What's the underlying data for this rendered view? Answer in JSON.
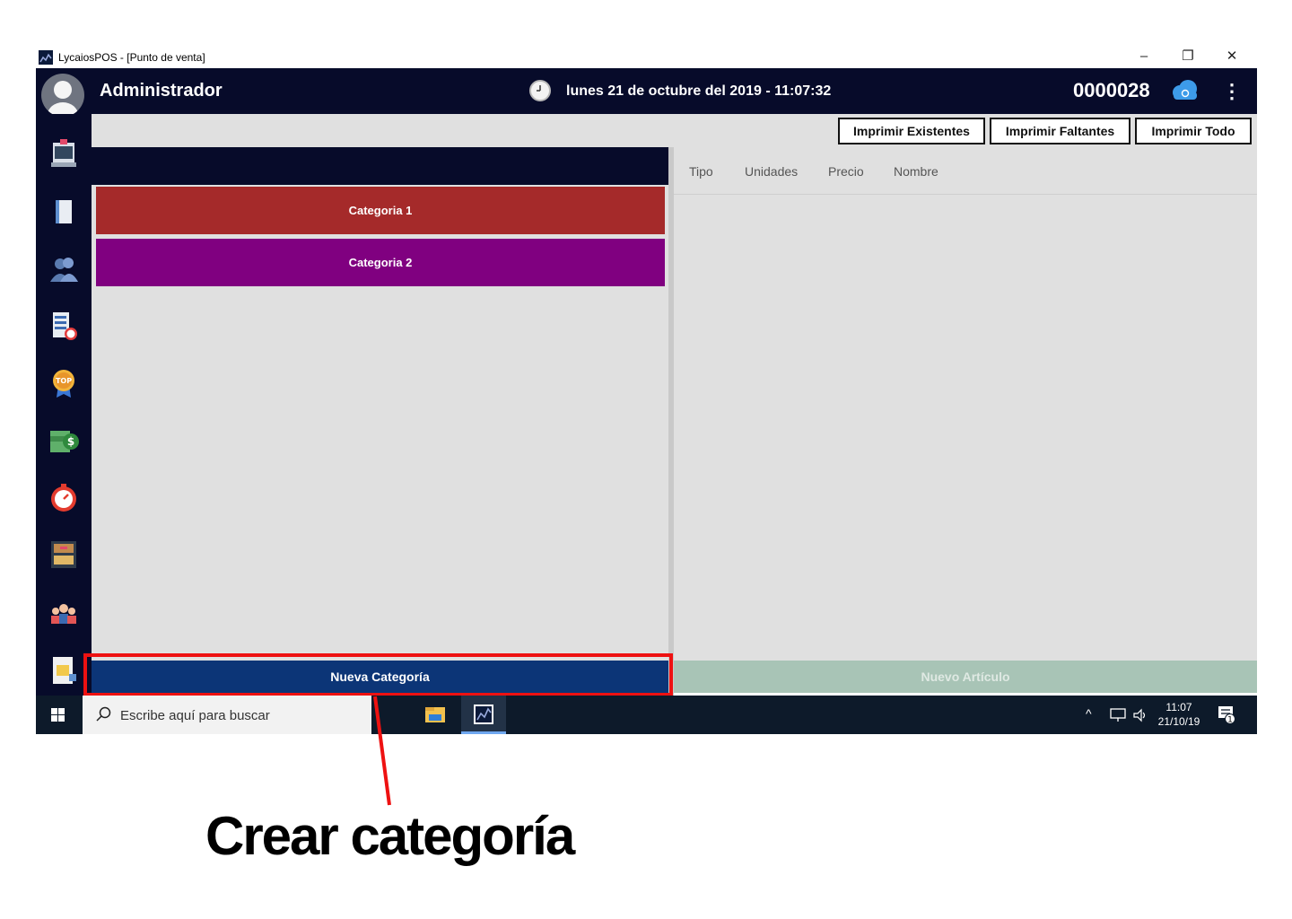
{
  "window": {
    "title": "LycaiosPOS - [Punto de venta]",
    "minimize_icon": "minimize-icon",
    "restore_icon": "restore-icon",
    "close_icon": "close-icon"
  },
  "header": {
    "user_name": "Administrador",
    "datetime": "lunes 21 de octubre del 2019 - 11:07:32",
    "folio": "0000028",
    "menu_glyph": "⋮"
  },
  "sidebar": {
    "items": [
      {
        "icon": "cash-register-icon"
      },
      {
        "icon": "notebook-icon"
      },
      {
        "icon": "clients-icon"
      },
      {
        "icon": "report-icon"
      },
      {
        "icon": "top-badge-icon",
        "label": "TOP"
      },
      {
        "icon": "money-icon"
      },
      {
        "icon": "timer-icon"
      },
      {
        "icon": "inventory-icon"
      },
      {
        "icon": "users-icon"
      },
      {
        "icon": "import-icon"
      }
    ]
  },
  "toolbar": {
    "print_existing": "Imprimir Existentes",
    "print_missing": "Imprimir Faltantes",
    "print_all": "Imprimir Todo"
  },
  "categories": [
    {
      "name": "Categoria 1",
      "color": "#a52a2a"
    },
    {
      "name": "Categoria 2",
      "color": "#800080"
    }
  ],
  "articles": {
    "columns": [
      "Tipo",
      "Unidades",
      "Precio",
      "Nombre"
    ]
  },
  "buttons": {
    "new_category": "Nueva Categoría",
    "new_article": "Nuevo Artículo"
  },
  "taskbar": {
    "search_placeholder": "Escribe aquí para buscar",
    "tray_glyphs": "^",
    "time": "11:07",
    "date": "21/10/19",
    "notification_count": "1"
  },
  "annotation": {
    "caption": "Crear categoría",
    "highlight_color": "#ee1111"
  }
}
